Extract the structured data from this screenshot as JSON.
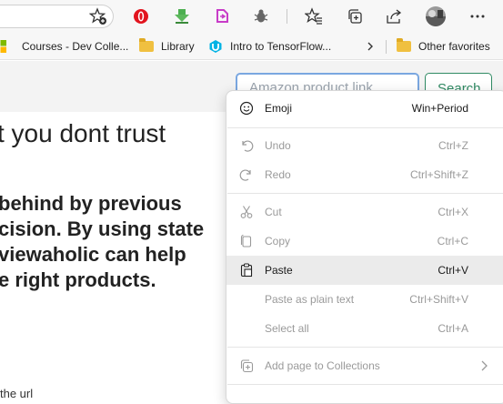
{
  "toolbar": {
    "icons": [
      "star-add-icon",
      "opera-icon",
      "download-extension-icon",
      "extension-g-icon",
      "bug-icon",
      "favorites-icon",
      "collections-icon",
      "share-icon",
      "profile-avatar",
      "more-icon"
    ]
  },
  "bookmarks": {
    "items": [
      {
        "label": "Courses - Dev Colle..."
      },
      {
        "label": "Library"
      },
      {
        "label": "Intro to TensorFlow..."
      }
    ],
    "other": "Other favorites"
  },
  "page": {
    "search_placeholder": "Amazon product link",
    "search_button": "Search",
    "headline": "t you dont trust",
    "paragraph": [
      "behind by previous",
      "cision. By using state",
      "viewaholic can help",
      "e right products."
    ],
    "footer_fragment": "the url"
  },
  "menu": {
    "items": [
      {
        "label": "Emoji",
        "shortcut": "Win+Period",
        "enabled": true
      },
      {
        "label": "Undo",
        "shortcut": "Ctrl+Z",
        "enabled": false
      },
      {
        "label": "Redo",
        "shortcut": "Ctrl+Shift+Z",
        "enabled": false
      },
      {
        "label": "Cut",
        "shortcut": "Ctrl+X",
        "enabled": false
      },
      {
        "label": "Copy",
        "shortcut": "Ctrl+C",
        "enabled": false
      },
      {
        "label": "Paste",
        "shortcut": "Ctrl+V",
        "enabled": true
      },
      {
        "label": "Paste as plain text",
        "shortcut": "Ctrl+Shift+V",
        "enabled": false
      },
      {
        "label": "Select all",
        "shortcut": "Ctrl+A",
        "enabled": false
      },
      {
        "label": "Add page to Collections",
        "shortcut": "",
        "enabled": false
      }
    ]
  },
  "colors": {
    "accent_green": "#2f8a63",
    "input_focus": "#7aa7e0",
    "menu_highlight": "#ebebeb"
  }
}
